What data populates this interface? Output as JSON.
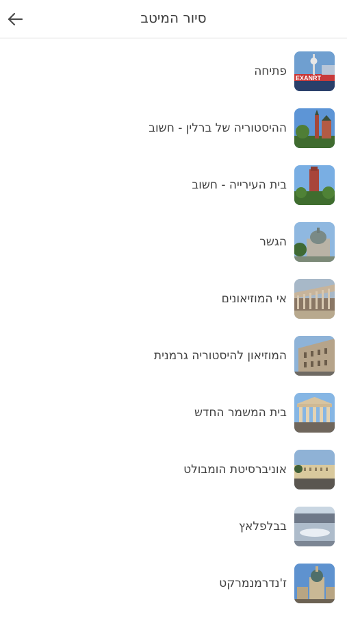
{
  "header": {
    "title": "סיור המיטב"
  },
  "stops": [
    {
      "label": "פתיחה",
      "icon": "photo-storefront-tower"
    },
    {
      "label": "ההיסטוריה של ברלין - חשוב",
      "icon": "photo-church-towers"
    },
    {
      "label": "בית העירייה - חשוב",
      "icon": "photo-red-city-hall"
    },
    {
      "label": "הגשר",
      "icon": "photo-domed-cathedral"
    },
    {
      "label": "אי המוזיאונים",
      "icon": "photo-colonnade-museum"
    },
    {
      "label": "המוזיאון להיסטוריה גרמנית",
      "icon": "photo-baroque-facade"
    },
    {
      "label": "בית המשמר החדש",
      "icon": "photo-temple-portico"
    },
    {
      "label": "אוניברסיטת הומבולט",
      "icon": "photo-university-building"
    },
    {
      "label": "בבלפלאץ",
      "icon": "photo-plaza-reflection"
    },
    {
      "label": "ז'נדרמנמרקט",
      "icon": "photo-domed-church"
    }
  ]
}
